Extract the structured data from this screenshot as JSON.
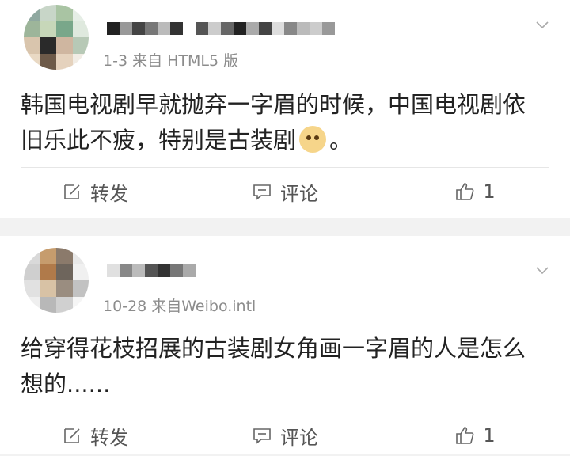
{
  "posts": [
    {
      "meta": "1-3  来自 HTML5 版",
      "content_part1": "韩国电视剧早就抛弃一字眉的时候，中国电视剧依旧乐此不疲，特别是古装剧",
      "content_part2": "。",
      "emoji": "doge-emoji",
      "actions": {
        "repost_label": "转发",
        "comment_label": "评论",
        "like_count": "1"
      }
    },
    {
      "meta": "10-28  来自Weibo.intl",
      "content_part1": "给穿得花枝招展的古装剧女角画一字眉的人是怎么想的......",
      "content_part2": "",
      "actions": {
        "repost_label": "转发",
        "comment_label": "评论",
        "like_count": "1"
      }
    }
  ],
  "colors": {
    "card_bg": "#ffffff",
    "page_bg": "#f2f2f2",
    "meta_text": "#8c8c8c",
    "body_text": "#222222"
  }
}
